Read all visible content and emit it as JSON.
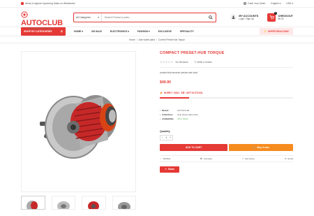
{
  "topbar": {
    "notice": "Items & regions Upcoming Sales on Weekends!",
    "track": "Track Your Order",
    "language": "English",
    "currency": "USD"
  },
  "header": {
    "logo_main": "AUTOCLUB",
    "logo_sub": "WHOLESALE PARTS",
    "search_category": "All Categories",
    "search_placeholder": "Search Product & parts...",
    "account_title": "MY ACCOUNTS",
    "account_links": "Login / Sign Up",
    "cart_count": "0",
    "cart_title": "CHECKOUT",
    "cart_total": "$0.00"
  },
  "nav": {
    "shop_label": "SHOP BY CATEGORIES",
    "items": [
      "HOME",
      "ON SALE",
      "ELECTRONICS",
      "FASHION",
      "EXCLUSIVE",
      "SPECIALITY"
    ],
    "deals_label": "SUPER DEALS BAY"
  },
  "breadcrumb": {
    "home": "Home",
    "sep": "/",
    "category": "Axle wheel parts",
    "current": "Current Preset Hub Torque"
  },
  "product": {
    "title": "COMPACT PRESET-HUB TORQUE",
    "reviews": "No Reviews",
    "write_review": "Write a review",
    "description": "product that ensures precise axle load",
    "price": "$49.90",
    "hurry_pre": "HURRY ! ONLY",
    "hurry_num": "16",
    "hurry_post": "LEFT IN STOCK.",
    "stock_fraction": 0.22,
    "brand_label": "Brand:",
    "brand_value": "AUTOCLUB",
    "collection_label": "Collection:",
    "collection_value": "Axle wheel parts bulk",
    "availability_label": "Availability:",
    "availability_value": "30 In Stock",
    "quantity_label": "Quantity",
    "quantity_value": "1",
    "add_to_cart": "ADD TO CART",
    "buy_now": "Buy it now",
    "wishlist": "Wishlist",
    "compare": "Compare",
    "ask": "Ask Quote",
    "email": "Email",
    "share": "Share"
  },
  "colors": {
    "accent": "#e53935",
    "orange": "#f68b1e"
  }
}
